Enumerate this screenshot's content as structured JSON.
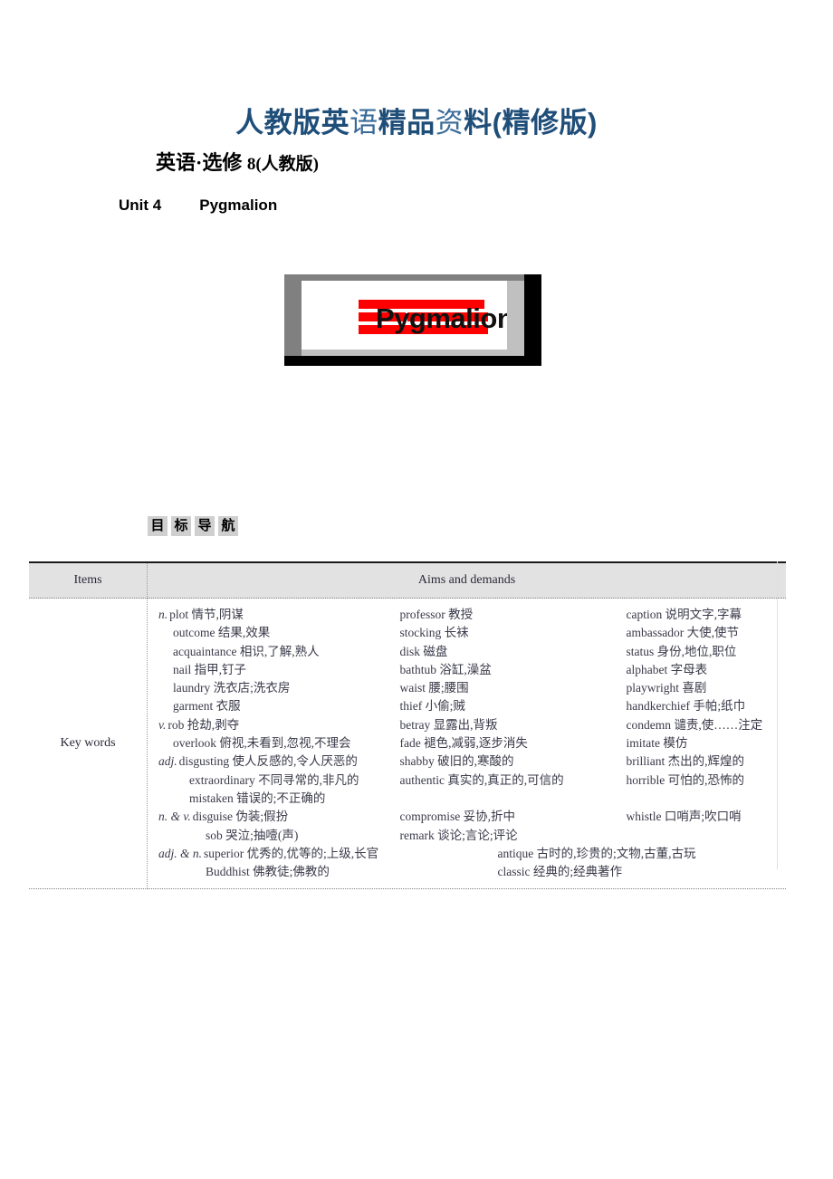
{
  "banner": {
    "segments": [
      {
        "text": "人教版英",
        "weight": "heavy"
      },
      {
        "text": "语",
        "weight": "light"
      },
      {
        "text": "精品",
        "weight": "heavy"
      },
      {
        "text": "资",
        "weight": "light"
      },
      {
        "text": "料(精修版)",
        "weight": "heavy"
      }
    ],
    "full_text": "人教版英语精品资料(精修版)",
    "color": "#1f4e79"
  },
  "subtitle": {
    "main": "英语·选修 ",
    "emphasis": "8(人教版)"
  },
  "unit_heading": {
    "unit": "Unit 4",
    "title": "Pygmalion"
  },
  "figure": {
    "caption_word": "Pygmalion",
    "accent_color": "#ff0000",
    "frame_color": "#808080",
    "inner_color": "#c0c0c0",
    "backdrop_color": "#000000"
  },
  "section_tag": {
    "chars": [
      "目",
      "标",
      "导",
      "航"
    ],
    "background": "#cfcfcf"
  },
  "table": {
    "headers": {
      "items": "Items",
      "aims": "Aims and demands"
    },
    "row_label": "Key words",
    "columns": [
      {
        "id": "column-left",
        "lines": [
          {
            "pos": "n.",
            "text": "plot 情节,阴谋",
            "indent": 0
          },
          {
            "pos": "",
            "text": "outcome 结果,效果",
            "indent": 1
          },
          {
            "pos": "",
            "text": "acquaintance 相识,了解,熟人",
            "indent": 1
          },
          {
            "pos": "",
            "text": "nail 指甲,钉子",
            "indent": 1
          },
          {
            "pos": "",
            "text": "laundry 洗衣店;洗衣房",
            "indent": 1
          },
          {
            "pos": "",
            "text": "garment 衣服",
            "indent": 1
          },
          {
            "pos": "v.",
            "text": "rob 抢劫,剥夺",
            "indent": 0
          },
          {
            "pos": "",
            "text": "overlook 俯视,未看到,忽视,不理会",
            "indent": 1
          },
          {
            "pos": "adj.",
            "text": "disgusting 使人反感的,令人厌恶的",
            "indent": 0
          },
          {
            "pos": "",
            "text": "extraordinary 不同寻常的,非凡的",
            "indent": 2
          },
          {
            "pos": "",
            "text": "mistaken 错误的;不正确的",
            "indent": 2
          },
          {
            "pos": "n. & v.",
            "text": "disguise 伪装;假扮",
            "indent": 0
          },
          {
            "pos": "",
            "text": "sob 哭泣;抽噎(声)",
            "indent": 3
          },
          {
            "pos": "adj. & n.",
            "text": "superior 优秀的,优等的;上级,长官",
            "indent": 0
          },
          {
            "pos": "",
            "text": "Buddhist 佛教徒;佛教的",
            "indent": 3
          }
        ]
      },
      {
        "id": "column-middle",
        "lines": [
          {
            "pos": "",
            "text": "professor 教授",
            "indent": 0
          },
          {
            "pos": "",
            "text": "stocking 长袜",
            "indent": 0
          },
          {
            "pos": "",
            "text": "disk 磁盘",
            "indent": 0
          },
          {
            "pos": "",
            "text": "bathtub 浴缸,澡盆",
            "indent": 0
          },
          {
            "pos": "",
            "text": "waist 腰;腰围",
            "indent": 0
          },
          {
            "pos": "",
            "text": "thief 小偷;贼",
            "indent": 0
          },
          {
            "pos": "",
            "text": "betray 显露出,背叛",
            "indent": 0
          },
          {
            "pos": "",
            "text": "fade 褪色,减弱,逐步消失",
            "indent": 0
          },
          {
            "pos": "",
            "text": "shabby 破旧的,寒酸的",
            "indent": 0
          },
          {
            "pos": "",
            "text": "authentic 真实的,真正的,可信的",
            "indent": 0
          },
          {
            "pos": "",
            "text": "",
            "indent": 0
          },
          {
            "pos": "",
            "text": "compromise 妥协,折中",
            "indent": 0
          },
          {
            "pos": "",
            "text": "remark 谈论;言论;评论",
            "indent": 0
          },
          {
            "pos": "",
            "text": "antique 古时的,珍贵的;文物,古董,古玩",
            "indent": 5
          },
          {
            "pos": "",
            "text": "classic 经典的;经典著作",
            "indent": 5
          }
        ]
      },
      {
        "id": "column-right",
        "lines": [
          {
            "pos": "",
            "text": "caption 说明文字,字幕",
            "indent": 0
          },
          {
            "pos": "",
            "text": "ambassador 大使,使节",
            "indent": 0
          },
          {
            "pos": "",
            "text": "status 身份,地位,职位",
            "indent": 0
          },
          {
            "pos": "",
            "text": "alphabet 字母表",
            "indent": 0
          },
          {
            "pos": "",
            "text": "playwright 喜剧",
            "indent": 0
          },
          {
            "pos": "",
            "text": "handkerchief 手帕;纸巾",
            "indent": 0
          },
          {
            "pos": "",
            "text": "condemn 谴责,使……注定",
            "indent": 0
          },
          {
            "pos": "",
            "text": "imitate 模仿",
            "indent": 0
          },
          {
            "pos": "",
            "text": "brilliant 杰出的,辉煌的",
            "indent": 0
          },
          {
            "pos": "",
            "text": "horrible 可怕的,恐怖的",
            "indent": 0
          },
          {
            "pos": "",
            "text": "",
            "indent": 0
          },
          {
            "pos": "",
            "text": "whistle 口哨声;吹口哨",
            "indent": 0
          }
        ]
      }
    ]
  }
}
